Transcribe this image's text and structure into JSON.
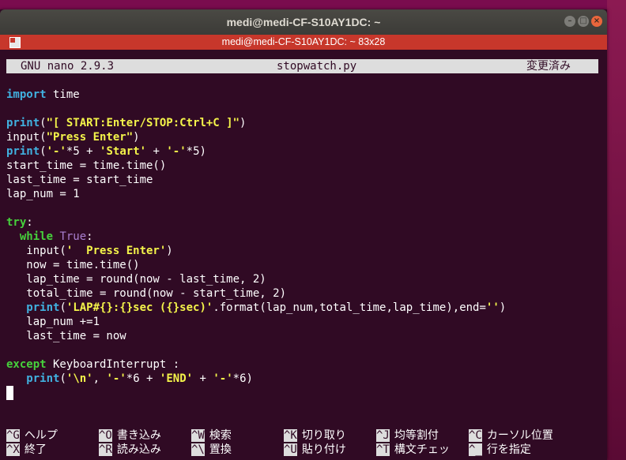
{
  "window": {
    "title": "medi@medi-CF-S10AY1DC: ~",
    "tab_title": "medi@medi-CF-S10AY1DC: ~ 83x28",
    "controls": {
      "minimize": "–",
      "maximize": "□",
      "close": "×"
    }
  },
  "nano": {
    "version": "GNU nano 2.9.3",
    "filename": "stopwatch.py",
    "status": "変更済み"
  },
  "code": {
    "l1_kw": "import",
    "l1_rest": " time",
    "l2_kw": "print",
    "l2_a": "(",
    "l2_str": "\"[ START:Enter/STOP:Ctrl+C ]\"",
    "l2_b": ")",
    "l3_a": "input(",
    "l3_str": "\"Press Enter\"",
    "l3_b": ")",
    "l4_kw": "print",
    "l4_a": "(",
    "l4_s1": "'-'",
    "l4_b": "*5 + ",
    "l4_s2": "'Start'",
    "l4_c": " + ",
    "l4_s3": "'-'",
    "l4_d": "*5)",
    "l5": "start_time = time.time()",
    "l6": "last_time = start_time",
    "l7": "lap_num = 1",
    "l8_kw": "try",
    "l8_rest": ":",
    "l9_indent": "  ",
    "l9_kw": "while",
    "l9_sp": " ",
    "l9_bi": "True",
    "l9_rest": ":",
    "l10_a": "   input(",
    "l10_str": "'  Press Enter'",
    "l10_b": ")",
    "l11": "   now = time.time()",
    "l12": "   lap_time = round(now - last_time, 2)",
    "l13": "   total_time = round(now - start_time, 2)",
    "l14_indent": "   ",
    "l14_kw": "print",
    "l14_a": "(",
    "l14_str": "'LAP#{}:{}sec ({}sec)'",
    "l14_b": ".format(lap_num,total_time,lap_time),end=",
    "l14_s2": "''",
    "l14_c": ")",
    "l15": "   lap_num +=1",
    "l16": "   last_time = now",
    "l17_kw": "except",
    "l17_rest": " KeyboardInterrupt :",
    "l18_indent": "   ",
    "l18_kw": "print",
    "l18_a": "(",
    "l18_s1": "'\\n'",
    "l18_b": ", ",
    "l18_s2": "'-'",
    "l18_c": "*6 + ",
    "l18_s3": "'END'",
    "l18_d": " + ",
    "l18_s4": "'-'",
    "l18_e": "*6)"
  },
  "shortcuts": {
    "row1": [
      {
        "key": "^G",
        "label": "ヘルプ"
      },
      {
        "key": "^O",
        "label": "書き込み"
      },
      {
        "key": "^W",
        "label": "検索"
      },
      {
        "key": "^K",
        "label": "切り取り"
      },
      {
        "key": "^J",
        "label": "均等割付"
      },
      {
        "key": "^C",
        "label": "カーソル位置"
      }
    ],
    "row2": [
      {
        "key": "^X",
        "label": "終了"
      },
      {
        "key": "^R",
        "label": "読み込み"
      },
      {
        "key": "^\\",
        "label": "置換"
      },
      {
        "key": "^U",
        "label": "貼り付け"
      },
      {
        "key": "^T",
        "label": "構文チェッ"
      },
      {
        "key": "^_",
        "label": "行を指定"
      }
    ]
  },
  "colors": {
    "terminal_bg": "#300a24",
    "keyword": "#41b1e0",
    "string": "#f4f44a",
    "builtin": "#a97fd0",
    "tab_bar": "#c7372b"
  }
}
